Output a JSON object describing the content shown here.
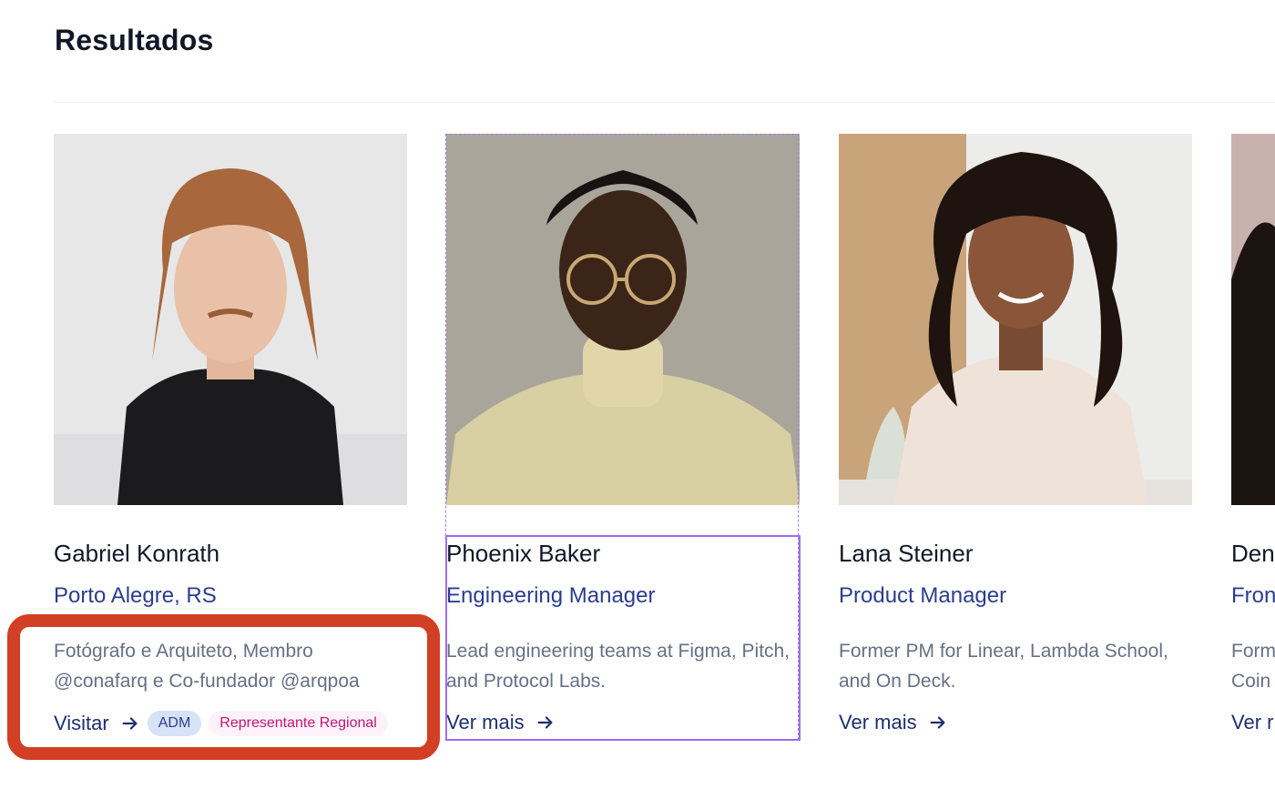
{
  "page": {
    "title": "Resultados"
  },
  "cards": [
    {
      "name": "Gabriel Konrath",
      "role": "Porto Alegre, RS",
      "bio": "Fotógrafo e Arquiteto, Membro @conafarq e Co-fundador @arqpoa",
      "link_label": "Visitar",
      "badges": [
        "ADM",
        "Representante Regional"
      ]
    },
    {
      "name": "Phoenix Baker",
      "role": "Engineering Manager",
      "bio": "Lead engineering teams at Figma, Pitch, and Protocol Labs.",
      "link_label": "Ver mais"
    },
    {
      "name": "Lana Steiner",
      "role": "Product Manager",
      "bio": "Former PM for Linear, Lambda School, and On Deck.",
      "link_label": "Ver mais"
    },
    {
      "name": "Den",
      "role": "Fron",
      "bio_line1": "Form",
      "bio_line2": "Coin",
      "link_label": "Ver r"
    }
  ],
  "colors": {
    "accent": "#2b3d8f",
    "highlight": "#d13f24",
    "selection": "#9a6df0"
  }
}
